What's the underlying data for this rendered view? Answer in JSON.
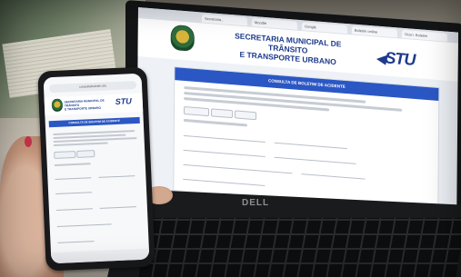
{
  "laptop": {
    "tabs": [
      "Secretaria...",
      "Moodle",
      "Google",
      "Boletim online",
      "Ocorr. Boletim"
    ],
    "header_title_line1": "SECRETARIA MUNICIPAL DE TRÂNSITO",
    "header_title_line2": "E TRANSPORTE URBANO",
    "logo_text": "STU",
    "card_heading": "CONSULTA DE BOLETIM DE ACIDENTE",
    "brand": "DELL"
  },
  "phone": {
    "url": "consultaboletim.stu",
    "header_title_line1": "SECRETARIA MUNICIPAL DE TRÂNSITO",
    "header_title_line2": "E TRANSPORTE URBANO",
    "logo_text": "STU",
    "card_heading": "CONSULTA DE BOLETIM DE ACIDENTE"
  },
  "colors": {
    "accent": "#2b57c4",
    "brand_blue": "#1d3a8c",
    "nail": "#c0334a"
  }
}
